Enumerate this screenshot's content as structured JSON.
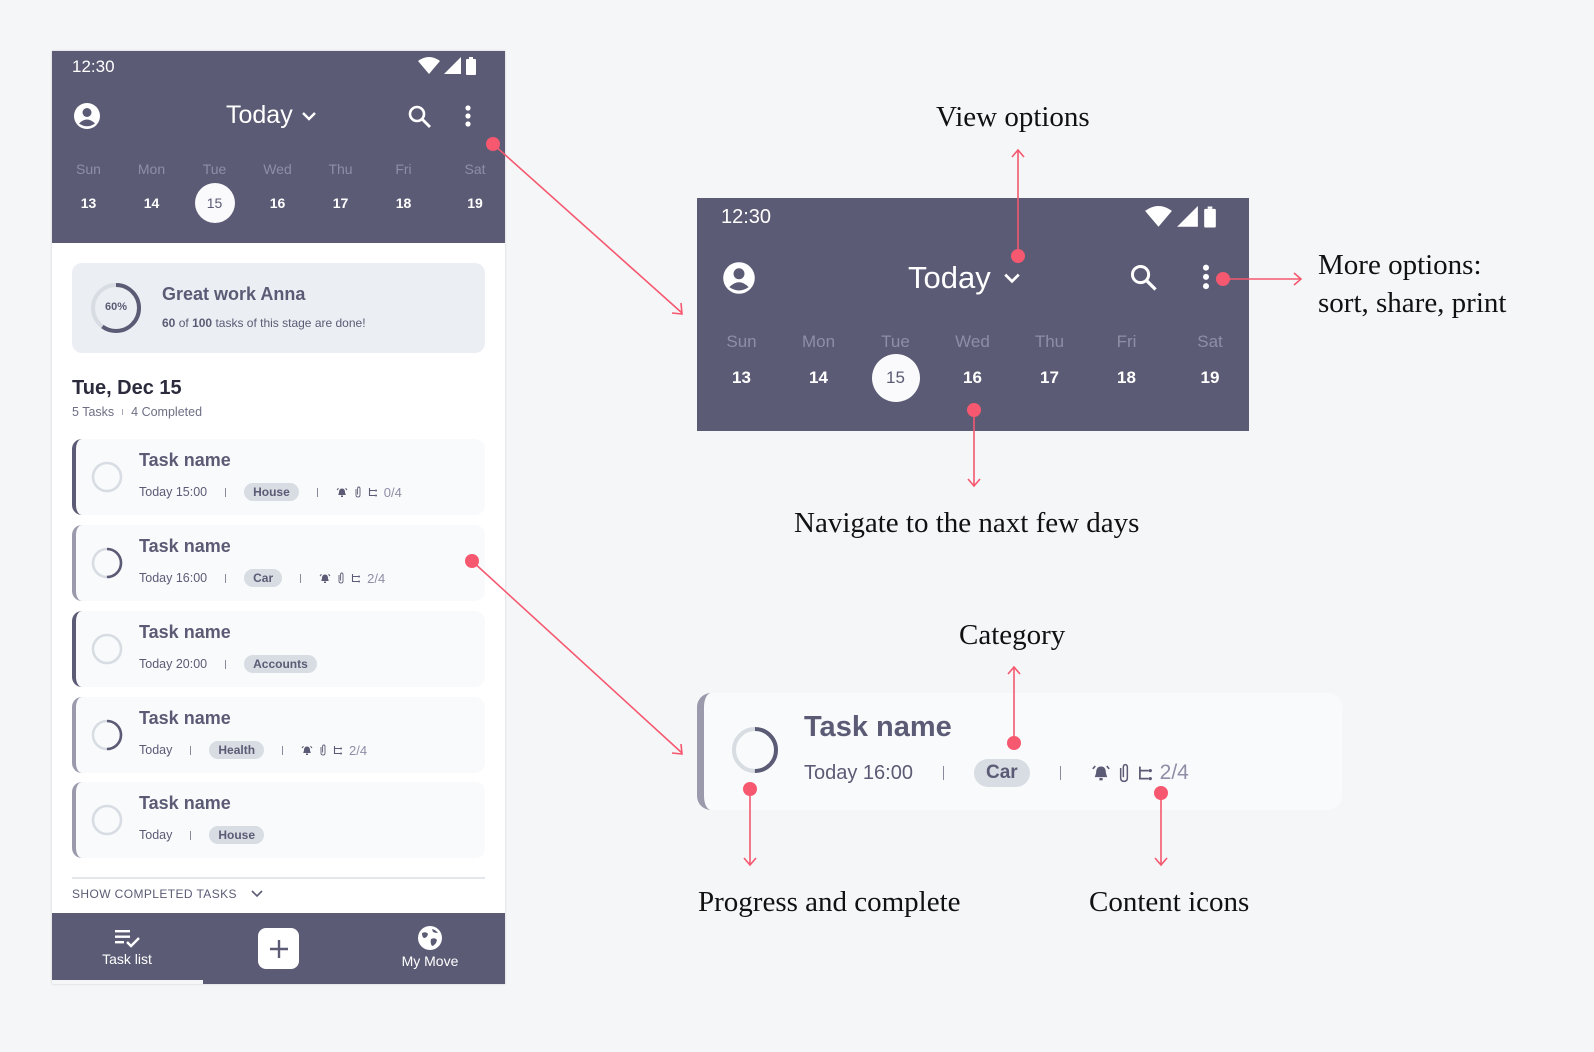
{
  "colors": {
    "primary": "#5b5b75",
    "accent_annotation": "#f5586f",
    "chip_bg": "#d7dde3",
    "background": "#f5f6f8"
  },
  "phone": {
    "status_bar": {
      "time": "12:30",
      "icons": [
        "wifi-icon",
        "signal-icon",
        "battery-icon"
      ]
    },
    "app_bar": {
      "title": "Today",
      "icons": {
        "profile": "account-circle-icon",
        "dropdown": "chevron-down-icon",
        "search": "search-icon",
        "more": "more-vert-icon"
      }
    },
    "week": {
      "days": [
        {
          "name": "Sun",
          "num": "13",
          "selected": false
        },
        {
          "name": "Mon",
          "num": "14",
          "selected": false
        },
        {
          "name": "Tue",
          "num": "15",
          "selected": true
        },
        {
          "name": "Wed",
          "num": "16",
          "selected": false
        },
        {
          "name": "Thu",
          "num": "17",
          "selected": false
        },
        {
          "name": "Fri",
          "num": "18",
          "selected": false
        },
        {
          "name": "Sat",
          "num": "19",
          "selected": false
        }
      ]
    },
    "summary": {
      "progress_percent": 60,
      "progress_label": "60%",
      "title": "Great work Anna",
      "done": "60",
      "of": "of",
      "total": "100",
      "suffix": "tasks of this stage are done!"
    },
    "date_header": {
      "title": "Tue, Dec 15",
      "tasks_count": "5 Tasks",
      "completed": "4 Completed"
    },
    "tasks": [
      {
        "name": "Task name",
        "time": "Today 15:00",
        "category": "House",
        "has_icons": true,
        "subtasks": "0/4",
        "progress": 0
      },
      {
        "name": "Task name",
        "time": "Today 16:00",
        "category": "Car",
        "has_icons": true,
        "subtasks": "2/4",
        "progress": 0.5
      },
      {
        "name": "Task name",
        "time": "Today 20:00",
        "category": "Accounts",
        "has_icons": false,
        "subtasks": "",
        "progress": 0
      },
      {
        "name": "Task name",
        "time": "Today",
        "category": "Health",
        "has_icons": true,
        "subtasks": "2/4",
        "progress": 0.5
      },
      {
        "name": "Task name",
        "time": "Today",
        "category": "House",
        "has_icons": false,
        "subtasks": "",
        "progress": 0
      }
    ],
    "show_completed": "SHOW COMPLETED TASKS",
    "bottom_nav": {
      "task_list": "Task list",
      "add": "+",
      "my_move": "My Move"
    }
  },
  "header_panel": {
    "time": "12:30",
    "title": "Today",
    "days": [
      {
        "name": "Sun",
        "num": "13"
      },
      {
        "name": "Mon",
        "num": "14"
      },
      {
        "name": "Tue",
        "num": "15"
      },
      {
        "name": "Wed",
        "num": "16"
      },
      {
        "name": "Thu",
        "num": "17"
      },
      {
        "name": "Fri",
        "num": "18"
      },
      {
        "name": "Sat",
        "num": "19"
      }
    ]
  },
  "task_panel": {
    "name": "Task name",
    "time": "Today 16:00",
    "category": "Car",
    "subtasks": "2/4",
    "progress": 0.5
  },
  "annotations": {
    "view_options": "View options",
    "more_options_1": "More options:",
    "more_options_2": "sort, share, print",
    "navigate": "Navigate to the naxt few days",
    "category": "Category",
    "progress": "Progress and complete",
    "content_icons": "Content icons"
  }
}
